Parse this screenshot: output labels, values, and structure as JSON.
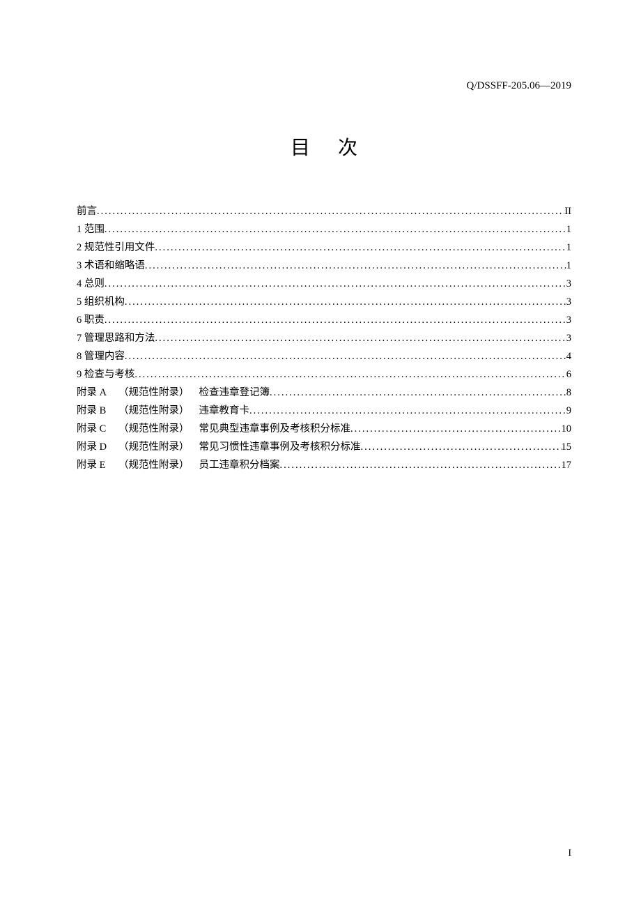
{
  "header": {
    "code": "Q/DSSFF-205.06—2019"
  },
  "title": "目次",
  "toc": {
    "entries": [
      {
        "label": "前言",
        "page": "II"
      },
      {
        "label": "1 范围",
        "page": "1"
      },
      {
        "label": "2 规范性引用文件",
        "page": "1"
      },
      {
        "label": "3 术语和缩略语",
        "page": "1"
      },
      {
        "label": "4 总则",
        "page": "3"
      },
      {
        "label": "5 组织机构",
        "page": "3"
      },
      {
        "label": "6 职责",
        "page": "3"
      },
      {
        "label": "7 管理思路和方法",
        "page": "3"
      },
      {
        "label": "8 管理内容",
        "page": "4"
      },
      {
        "label": "9 检查与考核",
        "page": "6"
      }
    ],
    "appendices": [
      {
        "prefix": "附录 A",
        "type": "（规范性附录）",
        "title": "检查违章登记簿",
        "page": "8"
      },
      {
        "prefix": "附录 B",
        "type": "（规范性附录）",
        "title": "违章教育卡",
        "page": "9"
      },
      {
        "prefix": "附录 C",
        "type": "（规范性附录）",
        "title": "常见典型违章事例及考核积分标准",
        "page": "10"
      },
      {
        "prefix": "附录 D",
        "type": "（规范性附录）",
        "title": "常见习惯性违章事例及考核积分标准",
        "page": "15"
      },
      {
        "prefix": "附录 E",
        "type": "（规范性附录）",
        "title": "员工违章积分档案",
        "page": "17"
      }
    ]
  },
  "footer": {
    "page_number": "I"
  }
}
